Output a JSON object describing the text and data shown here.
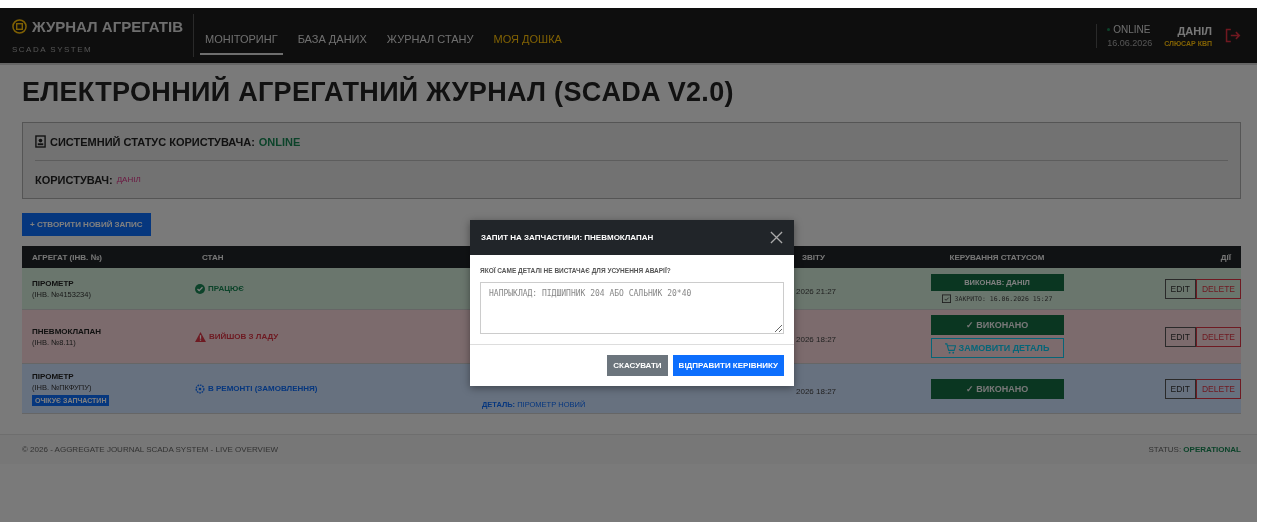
{
  "navbar": {
    "brand": "ЖУРНАЛ АГРЕГАТІВ",
    "subtitle": "SCADA SYSTEM",
    "links": [
      {
        "label": "МОНІТОРИНГ",
        "selected": true,
        "kind": "normal"
      },
      {
        "label": "БАЗА ДАНИХ",
        "selected": false,
        "kind": "normal"
      },
      {
        "label": "ЖУРНАЛ СТАНУ",
        "selected": false,
        "kind": "normal"
      },
      {
        "label": "МОЯ ДОШКА",
        "selected": false,
        "kind": "highlight"
      }
    ],
    "status": "ONLINE",
    "date": "16.06.2026",
    "user": "ДАНІЛ",
    "role": "СЛЮСАР КВП"
  },
  "page_title": "ЕЛЕКТРОННИЙ АГРЕГАТНИЙ ЖУРНАЛ (SCADA V2.0)",
  "status_panel": {
    "label": "СИСТЕМНИЙ СТАТУС КОРИСТУВАЧА:",
    "value": "ONLINE",
    "user_label": "КОРИСТУВАЧ:",
    "user": "ДАНІЛ"
  },
  "create_button": "+ СТВОРИТИ НОВИЙ ЗАПИС",
  "table": {
    "columns": {
      "aggregate": "АГРЕГАТ (ІНВ. №)",
      "state": "СТАН",
      "column_4": "ЗВІТУ",
      "control": "КЕРУВАННЯ СТАТУСОМ",
      "actions": "ДІЇ"
    },
    "rows": [
      {
        "name": "ПІРОМЕТР",
        "inv": "(ІНВ. №4153234)",
        "kind": "working",
        "state_text": "ПРАЦЮЄ",
        "date": "2026 21:27",
        "controls": [
          {
            "kind": "done_label",
            "label": "ВИКОНАВ: ДАНІЛ"
          },
          {
            "kind": "closed_note",
            "label": "ЗАКРИТО: 16.06.2026 15:27"
          }
        ],
        "actions": [
          "EDIT",
          "DELETE"
        ]
      },
      {
        "name": "ПНЕВМОКЛАПАН",
        "inv": "(ІНВ. №8.11)",
        "kind": "broken",
        "state_text": "ВИЙШОВ З ЛАДУ",
        "date": "2026 18:27",
        "controls": [
          {
            "kind": "done_button",
            "label": "✓ ВИКОНАНО"
          },
          {
            "kind": "order_button",
            "label": "ЗАМОВИТИ ДЕТАЛЬ"
          }
        ],
        "actions": [
          "EDIT",
          "DELETE"
        ]
      },
      {
        "name": "ПІРОМЕТР",
        "inv": "(ІНВ. №ПКФУПУ)",
        "badge": "ОЧІКУЄ ЗАПЧАСТИН",
        "kind": "repair",
        "state_text": "В РЕМОНТІ (ЗАМОВЛЕННЯ)",
        "detail": "**ДЕТАЛЬ:** ПІРОМЕТР НОВИЙ",
        "date": "2026 18:27",
        "controls": [
          {
            "kind": "done_button",
            "label": "✓ ВИКОНАНО"
          }
        ],
        "actions": [
          "EDIT",
          "DELETE"
        ]
      }
    ]
  },
  "footer": {
    "copyright": "© 2026 - AGGREGATE JOURNAL SCADA SYSTEM - LIVE OVERVIEW",
    "status_label": "STATUS:",
    "status_value": "OPERATIONAL"
  },
  "modal": {
    "title": "ЗАПИТ НА ЗАПЧАСТИНИ: ПНЕВМОКЛАПАН",
    "label": "ЯКОЇ САМЕ ДЕТАЛІ НЕ ВИСТАЧАЄ ДЛЯ УСУНЕННЯ АВАРІЇ?",
    "placeholder": "НАПРЫКЛАД: ПІДШИПНИК 204 АБО САЛЬНИК 20*40",
    "buttons": [
      {
        "label": "СКАСУВАТИ",
        "kind": "secondary"
      },
      {
        "label": "ВІДПРАВИТИ КЕРІВНИКУ",
        "kind": "primary"
      }
    ]
  }
}
